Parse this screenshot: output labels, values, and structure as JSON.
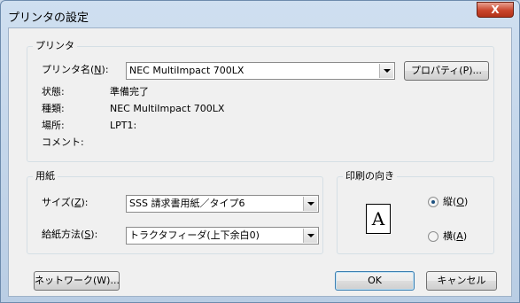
{
  "window": {
    "title": "プリンタの設定",
    "close_label": "X"
  },
  "printer": {
    "group_label": "プリンタ",
    "name_label_pre": "プリンタ名(",
    "name_label_key": "N",
    "name_label_post": "):",
    "name_value": "NEC MultiImpact 700LX",
    "properties_button": "プロパティ(P)...",
    "status_label": "状態:",
    "status_value": "準備完了",
    "type_label": "種類:",
    "type_value": "NEC MultiImpact 700LX",
    "where_label": "場所:",
    "where_value": "LPT1:",
    "comment_label": "コメント:"
  },
  "paper": {
    "group_label": "用紙",
    "size_label_pre": "サイズ(",
    "size_label_key": "Z",
    "size_label_post": "):",
    "size_value": "SSS 請求書用紙／タイプ6",
    "source_label_pre": "給紙方法(",
    "source_label_key": "S",
    "source_label_post": "):",
    "source_value": "トラクタフィーダ(上下余白0)"
  },
  "orientation": {
    "group_label": "印刷の向き",
    "icon_letter": "A",
    "portrait_label_pre": "縦(",
    "portrait_label_key": "O",
    "portrait_label_post": ")",
    "landscape_label_pre": "横(",
    "landscape_label_key": "A",
    "landscape_label_post": ")",
    "selected": "portrait"
  },
  "footer": {
    "network_button": "ネットワーク(W)...",
    "ok_button": "OK",
    "cancel_button": "キャンセル"
  }
}
